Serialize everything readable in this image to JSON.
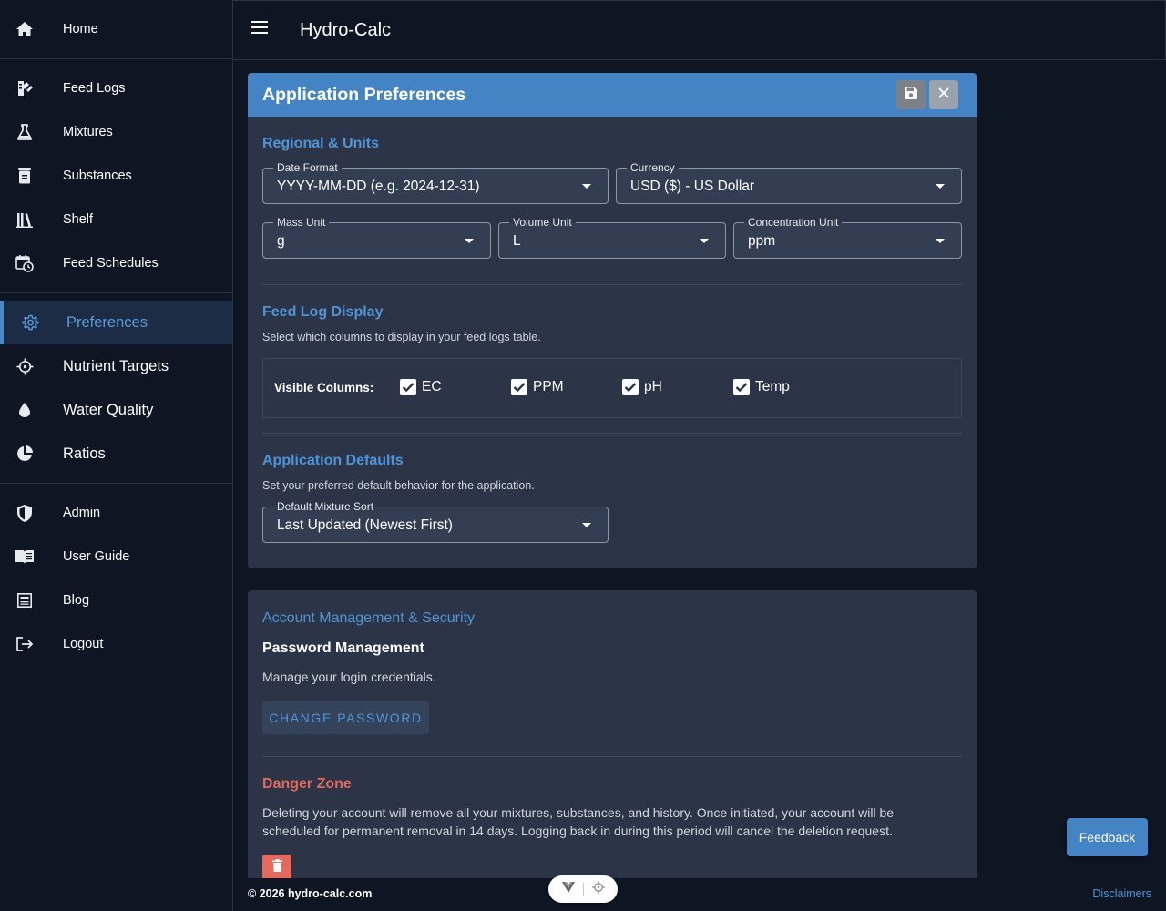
{
  "sidebar": {
    "items": [
      {
        "label": "Home",
        "icon": "home-icon"
      },
      {
        "label": "Feed Logs",
        "icon": "feed-logs-icon"
      },
      {
        "label": "Mixtures",
        "icon": "flask-icon"
      },
      {
        "label": "Substances",
        "icon": "jar-icon"
      },
      {
        "label": "Shelf",
        "icon": "shelf-icon"
      },
      {
        "label": "Feed Schedules",
        "icon": "calendar-clock-icon"
      },
      {
        "label": "Preferences",
        "icon": "gear-icon"
      },
      {
        "label": "Nutrient Targets",
        "icon": "crosshair-icon"
      },
      {
        "label": "Water Quality",
        "icon": "water-drop-icon"
      },
      {
        "label": "Ratios",
        "icon": "pie-chart-icon"
      },
      {
        "label": "Admin",
        "icon": "shield-icon"
      },
      {
        "label": "User Guide",
        "icon": "book-icon"
      },
      {
        "label": "Blog",
        "icon": "blog-icon"
      },
      {
        "label": "Logout",
        "icon": "logout-icon"
      }
    ]
  },
  "topbar": {
    "title": "Hydro-Calc"
  },
  "preferences": {
    "title": "Application Preferences",
    "regional": {
      "title": "Regional & Units",
      "date_format": {
        "label": "Date Format",
        "value": "YYYY-MM-DD (e.g. 2024-12-31)"
      },
      "currency": {
        "label": "Currency",
        "value": "USD ($) - US Dollar"
      },
      "mass_unit": {
        "label": "Mass Unit",
        "value": "g"
      },
      "volume_unit": {
        "label": "Volume Unit",
        "value": "L"
      },
      "concentration_unit": {
        "label": "Concentration Unit",
        "value": "ppm"
      }
    },
    "feed_log": {
      "title": "Feed Log Display",
      "desc": "Select which columns to display in your feed logs table.",
      "visible_label": "Visible Columns:",
      "columns": [
        {
          "label": "EC",
          "checked": true
        },
        {
          "label": "PPM",
          "checked": true
        },
        {
          "label": "pH",
          "checked": true
        },
        {
          "label": "Temp",
          "checked": true
        }
      ]
    },
    "defaults": {
      "title": "Application Defaults",
      "desc": "Set your preferred default behavior for the application.",
      "mixture_sort": {
        "label": "Default Mixture Sort",
        "value": "Last Updated (Newest First)"
      }
    }
  },
  "account": {
    "title": "Account Management & Security",
    "password_title": "Password Management",
    "password_desc": "Manage your login credentials.",
    "change_password": "CHANGE PASSWORD",
    "danger_title": "Danger Zone",
    "danger_desc": "Deleting your account will remove all your mixtures, substances, and history. Once initiated, your account will be scheduled for permanent removal in 14 days. Logging back in during this period will cancel the deletion request."
  },
  "footer": {
    "copyright": "© 2026 hydro-calc.com",
    "disclaimers": "Disclaimers"
  },
  "feedback": "Feedback",
  "colors": {
    "accent": "#4484c4",
    "danger": "#e2685c",
    "background": "#0f1623",
    "panel": "#2b3547"
  }
}
